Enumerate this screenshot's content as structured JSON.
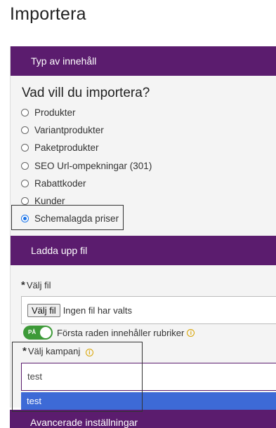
{
  "page": {
    "title": "Importera"
  },
  "content_type": {
    "header": "Typ av innehåll",
    "question": "Vad vill du importera?",
    "options": [
      {
        "label": "Produkter",
        "checked": false
      },
      {
        "label": "Variantprodukter",
        "checked": false
      },
      {
        "label": "Paketprodukter",
        "checked": false
      },
      {
        "label": "SEO Url-ompekningar (301)",
        "checked": false
      },
      {
        "label": "Rabattkoder",
        "checked": false
      },
      {
        "label": "Kunder",
        "checked": false
      },
      {
        "label": "Schemalagda priser",
        "checked": true
      }
    ]
  },
  "upload": {
    "header": "Ladda upp fil",
    "file_label": "Välj fil",
    "file_button": "Välj fil",
    "file_status": "Ingen fil har valts",
    "toggle_state": "PÅ",
    "toggle_label": "Första raden innehåller rubriker",
    "campaign_label": "Välj kampanj",
    "campaign_value": "test",
    "required_mark": "*",
    "info_icon": "i"
  },
  "dropdown": {
    "option": "test"
  },
  "advanced": {
    "header": "Avancerade inställningar"
  },
  "colors": {
    "brand": "#5b1c6e",
    "toggle_on": "#3d9a38",
    "selected_option": "#3d6ad6",
    "info": "#d9a400"
  }
}
